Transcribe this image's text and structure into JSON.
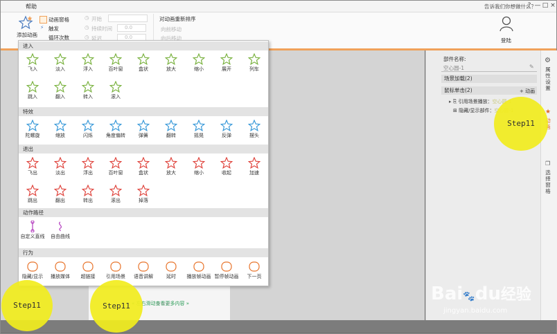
{
  "topbar": {
    "help": "帮助",
    "tell_me": "告诉我们你想做什么？",
    "buttons": [
      "?",
      "—",
      "□",
      "×"
    ]
  },
  "ribbon": {
    "add_animation": "添加动画",
    "animation_pane": "动画窗格",
    "trigger": "触发",
    "loop": "循环次数",
    "start": "开始",
    "duration": "持续时间",
    "delay": "延迟",
    "duration_value": "0.0",
    "delay_value": "0.0",
    "reorder": "对动画重新排序",
    "move_earlier": "向前移动",
    "move_later": "向后移动",
    "login": "登陆"
  },
  "panel": {
    "sections": [
      {
        "title": "进入",
        "color": "#7cb342",
        "items": [
          "飞入",
          "淡入",
          "浮入",
          "百叶窗",
          "盒状",
          "放大",
          "缩小",
          "展开",
          "列车",
          "跳入",
          "翻入",
          "转入",
          "滚入"
        ]
      },
      {
        "title": "特效",
        "color": "#3a9ad9",
        "items": [
          "陀螺旋",
          "缩放",
          "闪烁",
          "角度偏转",
          "弹簧",
          "翻转",
          "摇晃",
          "反弹",
          "摆头"
        ]
      },
      {
        "title": "退出",
        "color": "#e0463f",
        "items": [
          "飞出",
          "淡出",
          "浮出",
          "百叶窗",
          "盒状",
          "放大",
          "缩小",
          "收起",
          "加速",
          "跳出",
          "翻出",
          "转出",
          "滚出",
          "掉落"
        ]
      },
      {
        "title": "动作路径",
        "color": "#b43fbf",
        "items": [
          "自定义直线",
          "自由曲线"
        ]
      },
      {
        "title": "行为",
        "color": "#e8732a",
        "items": [
          "隐藏/显示",
          "播放媒体",
          "超链接",
          "引用场景",
          "语音讲解",
          "延时",
          "播放帧动画",
          "暂停帧动画",
          "下一页"
        ]
      }
    ]
  },
  "right_pane": {
    "part_name_label": "部件名称:",
    "part_name_value": "空心圆-1",
    "scene_load": "场景加载(2)",
    "mouse_click": "鼠标单击(2)",
    "add_action": "+ 动画",
    "action_1_label": "引用场景播放：",
    "action_1_target": "空心圆-1",
    "action_2_label": "隐藏/显示部件：",
    "action_2_target": "空心圆-1"
  },
  "sidebar": {
    "properties": "属性设置",
    "animation": "动画",
    "selection": "选择窗格"
  },
  "slide": {
    "hint": "左右滑动查看更多内容"
  },
  "highlights": [
    "Step11",
    "Step11",
    "Step11"
  ],
  "watermark": {
    "brand": "Bai",
    "paw": "du",
    "cn": "经验",
    "url": "jingyan.baidu.com"
  },
  "colors": {
    "accent": "#f0a15a",
    "highlight": "#f2ed1e",
    "enter": "#7cb342",
    "effect": "#3a9ad9",
    "exit": "#e0463f",
    "path": "#b43fbf",
    "behavior": "#e8732a"
  }
}
